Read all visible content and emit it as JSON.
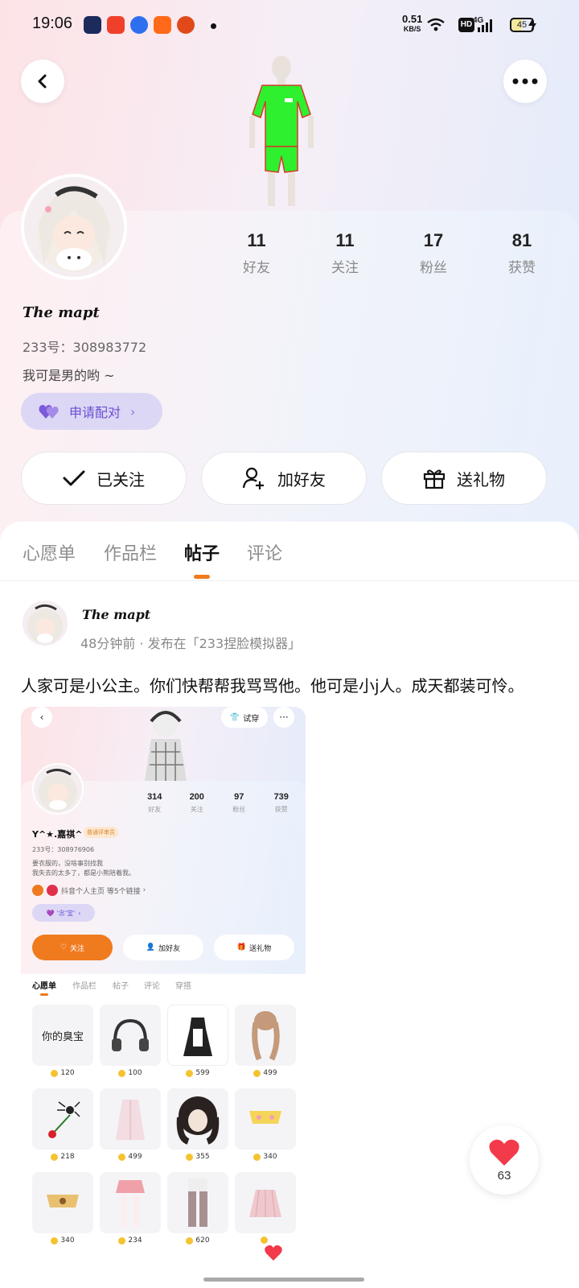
{
  "status_bar": {
    "time": "19:06",
    "net_speed_value": "0.51",
    "net_speed_unit": "KB/S",
    "hd_label": "HD",
    "network": "4G",
    "battery": "45"
  },
  "profile": {
    "username": "The mapt",
    "id_line": "233号：308983772",
    "bio": "我可是男的哟 ~",
    "pair_button": "申请配对",
    "stats": [
      {
        "num": "11",
        "label": "好友"
      },
      {
        "num": "11",
        "label": "关注"
      },
      {
        "num": "17",
        "label": "粉丝"
      },
      {
        "num": "81",
        "label": "获赞"
      }
    ],
    "actions": {
      "following": "已关注",
      "add_friend": "加好友",
      "send_gift": "送礼物"
    }
  },
  "tabs": [
    "心愿单",
    "作品栏",
    "帖子",
    "评论"
  ],
  "active_tab": "帖子",
  "post": {
    "author": "The mapt",
    "meta": "48分钟前 · 发布在「233捏脸模拟器」",
    "text": "人家可是小公主。你们快帮帮我骂骂他。他可是小j人。成天都装可怜。",
    "likes": "63"
  },
  "embedded_screenshot": {
    "try_on": "试穿",
    "name": "Y^★.嘉祺^",
    "badge": "普通评审员",
    "id_line": "233号：308976906",
    "bio_lines": [
      "要衣服的，没啥事别找我",
      "我失去的太多了，都是小熊陪着我。"
    ],
    "link_text": "抖音个人主页 等5个链接",
    "pair": "'念'宝'",
    "stats": [
      {
        "num": "314",
        "label": "好友"
      },
      {
        "num": "200",
        "label": "关注"
      },
      {
        "num": "97",
        "label": "粉丝"
      },
      {
        "num": "739",
        "label": "获赞"
      }
    ],
    "actions": {
      "follow": "关注",
      "add_friend": "加好友",
      "send_gift": "送礼物"
    },
    "tabs": [
      "心愿单",
      "作品栏",
      "帖子",
      "评论",
      "穿搭"
    ],
    "items": [
      {
        "label": "你的臭宝",
        "price": "120"
      },
      {
        "label": "",
        "price": "100"
      },
      {
        "label": "",
        "price": "599"
      },
      {
        "label": "",
        "price": "499"
      },
      {
        "label": "",
        "price": "218"
      },
      {
        "label": "",
        "price": "499"
      },
      {
        "label": "",
        "price": "355"
      },
      {
        "label": "",
        "price": "340"
      },
      {
        "label": "",
        "price": "340"
      },
      {
        "label": "",
        "price": "234"
      },
      {
        "label": "",
        "price": "620"
      },
      {
        "label": "",
        "price": ""
      }
    ]
  },
  "colors": {
    "accent_orange": "#f07a1e",
    "pair_purple": "#6a4fcf",
    "like_red": "#f23a4a"
  }
}
